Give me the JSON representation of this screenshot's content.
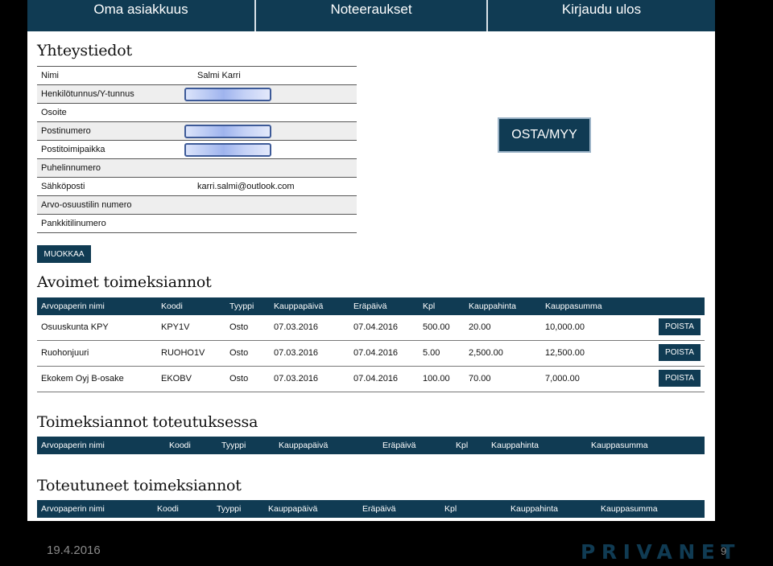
{
  "nav": {
    "items": [
      "Oma asiakkuus",
      "Noteeraukset",
      "Kirjaudu ulos"
    ]
  },
  "contact": {
    "heading": "Yhteystiedot",
    "rows": [
      {
        "label": "Nimi",
        "value": "Salmi Karri"
      },
      {
        "label": "Henkilötunnus/Y-tunnus",
        "value": ""
      },
      {
        "label": "Osoite",
        "value": ""
      },
      {
        "label": "Postinumero",
        "value": ""
      },
      {
        "label": "Postitoimipaikka",
        "value": ""
      },
      {
        "label": "Puhelinnumero",
        "value": ""
      },
      {
        "label": "Sähköposti",
        "value": "karri.salmi@outlook.com"
      },
      {
        "label": "Arvo-osuustilin numero",
        "value": ""
      },
      {
        "label": "Pankkitilinumero",
        "value": ""
      }
    ],
    "edit_label": "MUOKKAA"
  },
  "trade_button": "OSTA/MYY",
  "open_orders": {
    "heading": "Avoimet toimeksiannot",
    "columns": [
      "Arvopaperin nimi",
      "Koodi",
      "Tyyppi",
      "Kauppapäivä",
      "Eräpäivä",
      "Kpl",
      "Kauppahinta",
      "Kauppasumma"
    ],
    "rows": [
      [
        "Osuuskunta KPY",
        "KPY1V",
        "Osto",
        "07.03.2016",
        "07.04.2016",
        "500.00",
        "20.00",
        "10,000.00"
      ],
      [
        "Ruohonjuuri",
        "RUOHO1V",
        "Osto",
        "07.03.2016",
        "07.04.2016",
        "5.00",
        "2,500.00",
        "12,500.00"
      ],
      [
        "Ekokem Oyj B-osake",
        "EKOBV",
        "Osto",
        "07.03.2016",
        "07.04.2016",
        "100.00",
        "70.00",
        "7,000.00"
      ]
    ],
    "delete_label": "POISTA"
  },
  "pending_orders": {
    "heading": "Toimeksiannot toteutuksessa",
    "columns": [
      "Arvopaperin nimi",
      "Koodi",
      "Tyyppi",
      "Kauppapäivä",
      "Eräpäivä",
      "Kpl",
      "Kauppahinta",
      "Kauppasumma"
    ]
  },
  "completed_orders": {
    "heading": "Toteutuneet toimeksiannot",
    "columns": [
      "Arvopaperin nimi",
      "Koodi",
      "Tyyppi",
      "Kauppapäivä",
      "Eräpäivä",
      "Kpl",
      "Kauppahinta",
      "Kauppasumma"
    ]
  },
  "footer": {
    "date": "19.4.2016",
    "logo": "PRIVANET",
    "page": "9"
  },
  "colors": {
    "primary": "#103b53",
    "background": "#000000",
    "redaction": "#3d5a98"
  }
}
